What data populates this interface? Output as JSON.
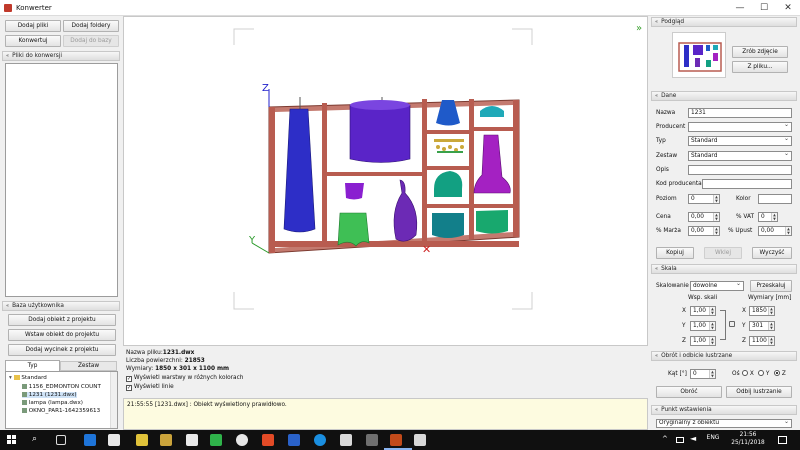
{
  "window": {
    "title": "Konwerter",
    "minimize": "—",
    "maximize": "☐",
    "close": "✕"
  },
  "toolbar": {
    "add_files": "Dodaj pliki",
    "add_folders": "Dodaj foldery",
    "convert": "Konwertuj",
    "add_to_db": "Dodaj do bazy"
  },
  "files_panel": {
    "header": "Pliki do konwersji"
  },
  "user_db": {
    "header": "Baza użytkownika",
    "add_object": "Dodaj obiekt z projektu",
    "insert_object": "Wstaw obiekt do projektu",
    "add_result": "Dodaj wycinek z projektu",
    "tab_type": "Typ",
    "tab_set": "Zestaw",
    "tree": [
      "Standard",
      "1156_EDMONTON COUNT",
      "1231 (1231.dwx)",
      "lampa (lampa.dwx)",
      "OKNO_PAR1-1642359613"
    ]
  },
  "file_info": {
    "name_label": "Nazwa pliku:",
    "name_value": "1231.dwx",
    "faces_label": "Liczba powierzchni:",
    "faces_value": "21853",
    "dims_label": "Wymiary:",
    "dims_value": "1850 x 301 x 1100 mm",
    "opt_colors": "Wyświetl warstwy w różnych kolorach",
    "opt_lines": "Wyświetl linie"
  },
  "log": {
    "text": "21:55:55 [1231.dwx] : Obiekt wyświetlony prawidłowo."
  },
  "preview": {
    "header": "Podgląd",
    "snapshot": "Zrób zdjęcie",
    "from_file": "Z pliku..."
  },
  "data": {
    "header": "Dane",
    "name_label": "Nazwa",
    "name_value": "1231",
    "producer_label": "Producent",
    "producer_value": "",
    "type_label": "Typ",
    "type_value": "Standard",
    "set_label": "Zestaw",
    "set_value": "Standard",
    "desc_label": "Opis",
    "code_label": "Kod producenta",
    "level_label": "Poziom",
    "level_value": "0",
    "color_label": "Kolor",
    "price_label": "Cena",
    "price_value": "0,00",
    "vat_label": "% VAT",
    "vat_value": "0",
    "margin_label": "% Marża",
    "margin_value": "0,00",
    "discount_label": "% Upust",
    "discount_value": "0,00",
    "copy": "Kopiuj",
    "paste": "Wklej",
    "clear": "Wyczyść"
  },
  "scale": {
    "header": "Skala",
    "scaling_label": "Skalowanie",
    "scaling_value": "dowolne",
    "rescale": "Przeskaluj",
    "factor_label": "Wsp. skali",
    "dims_label": "Wymiary [mm]",
    "x_label": "X",
    "y_label": "Y",
    "z_label": "Z",
    "fx": "1,00",
    "fy": "1,00",
    "fz": "1,00",
    "dx": "1850",
    "dy": "301",
    "dz": "1100"
  },
  "rotate": {
    "header": "Obrót i odbicie lustrzane",
    "angle_label": "Kąt [°]",
    "angle_value": "0",
    "axis_label": "Oś",
    "ax_x": "X",
    "ax_y": "Y",
    "ax_z": "Z",
    "rotate_btn": "Obróć",
    "mirror_btn": "Odbij lustrzanie"
  },
  "insert_point": {
    "header": "Punkt wstawienia",
    "value": "Oryginalny z obiektu"
  },
  "taskbar": {
    "time": "21:56",
    "date": "25/11/2018"
  }
}
